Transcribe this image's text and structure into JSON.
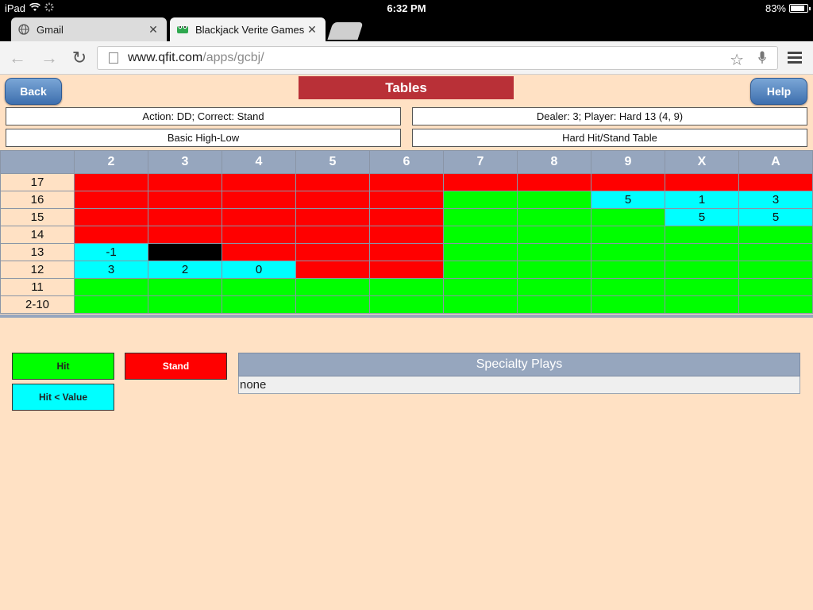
{
  "statusbar": {
    "device": "iPad",
    "time": "6:32 PM",
    "battery": "83%",
    "battery_level": 0.83
  },
  "tabs": [
    {
      "title": "Gmail",
      "active": false
    },
    {
      "title": "Blackjack Verite Games",
      "active": true
    }
  ],
  "toolbar": {
    "url_host": "www.qfit.com",
    "url_path": "/apps/gcbj/"
  },
  "page": {
    "back_label": "Back",
    "help_label": "Help",
    "title": "Tables",
    "action_text": "Action: DD; Correct: Stand",
    "dealer_text": "Dealer: 3; Player: Hard 13 (4, 9)",
    "system_text": "Basic High-Low",
    "table_name": "Hard Hit/Stand Table"
  },
  "grid": {
    "columns": [
      "2",
      "3",
      "4",
      "5",
      "6",
      "7",
      "8",
      "9",
      "X",
      "A"
    ],
    "rows": [
      {
        "label": "17",
        "cells": [
          {
            "c": "red",
            "v": ""
          },
          {
            "c": "red",
            "v": ""
          },
          {
            "c": "red",
            "v": ""
          },
          {
            "c": "red",
            "v": ""
          },
          {
            "c": "red",
            "v": ""
          },
          {
            "c": "red",
            "v": ""
          },
          {
            "c": "red",
            "v": ""
          },
          {
            "c": "red",
            "v": ""
          },
          {
            "c": "red",
            "v": ""
          },
          {
            "c": "red",
            "v": ""
          }
        ]
      },
      {
        "label": "16",
        "cells": [
          {
            "c": "red",
            "v": ""
          },
          {
            "c": "red",
            "v": ""
          },
          {
            "c": "red",
            "v": ""
          },
          {
            "c": "red",
            "v": ""
          },
          {
            "c": "red",
            "v": ""
          },
          {
            "c": "green",
            "v": ""
          },
          {
            "c": "green",
            "v": ""
          },
          {
            "c": "cyan",
            "v": "5"
          },
          {
            "c": "cyan",
            "v": "1"
          },
          {
            "c": "cyan",
            "v": "3"
          }
        ]
      },
      {
        "label": "15",
        "cells": [
          {
            "c": "red",
            "v": ""
          },
          {
            "c": "red",
            "v": ""
          },
          {
            "c": "red",
            "v": ""
          },
          {
            "c": "red",
            "v": ""
          },
          {
            "c": "red",
            "v": ""
          },
          {
            "c": "green",
            "v": ""
          },
          {
            "c": "green",
            "v": ""
          },
          {
            "c": "green",
            "v": ""
          },
          {
            "c": "cyan",
            "v": "5"
          },
          {
            "c": "cyan",
            "v": "5"
          }
        ]
      },
      {
        "label": "14",
        "cells": [
          {
            "c": "red",
            "v": ""
          },
          {
            "c": "red",
            "v": ""
          },
          {
            "c": "red",
            "v": ""
          },
          {
            "c": "red",
            "v": ""
          },
          {
            "c": "red",
            "v": ""
          },
          {
            "c": "green",
            "v": ""
          },
          {
            "c": "green",
            "v": ""
          },
          {
            "c": "green",
            "v": ""
          },
          {
            "c": "green",
            "v": ""
          },
          {
            "c": "green",
            "v": ""
          }
        ]
      },
      {
        "label": "13",
        "cells": [
          {
            "c": "cyan",
            "v": "-1"
          },
          {
            "c": "black",
            "v": ""
          },
          {
            "c": "red",
            "v": ""
          },
          {
            "c": "red",
            "v": ""
          },
          {
            "c": "red",
            "v": ""
          },
          {
            "c": "green",
            "v": ""
          },
          {
            "c": "green",
            "v": ""
          },
          {
            "c": "green",
            "v": ""
          },
          {
            "c": "green",
            "v": ""
          },
          {
            "c": "green",
            "v": ""
          }
        ]
      },
      {
        "label": "12",
        "cells": [
          {
            "c": "cyan",
            "v": "3"
          },
          {
            "c": "cyan",
            "v": "2"
          },
          {
            "c": "cyan",
            "v": "0"
          },
          {
            "c": "red",
            "v": ""
          },
          {
            "c": "red",
            "v": ""
          },
          {
            "c": "green",
            "v": ""
          },
          {
            "c": "green",
            "v": ""
          },
          {
            "c": "green",
            "v": ""
          },
          {
            "c": "green",
            "v": ""
          },
          {
            "c": "green",
            "v": ""
          }
        ]
      },
      {
        "label": "11",
        "cells": [
          {
            "c": "green",
            "v": ""
          },
          {
            "c": "green",
            "v": ""
          },
          {
            "c": "green",
            "v": ""
          },
          {
            "c": "green",
            "v": ""
          },
          {
            "c": "green",
            "v": ""
          },
          {
            "c": "green",
            "v": ""
          },
          {
            "c": "green",
            "v": ""
          },
          {
            "c": "green",
            "v": ""
          },
          {
            "c": "green",
            "v": ""
          },
          {
            "c": "green",
            "v": ""
          }
        ]
      },
      {
        "label": "2-10",
        "cells": [
          {
            "c": "green",
            "v": ""
          },
          {
            "c": "green",
            "v": ""
          },
          {
            "c": "green",
            "v": ""
          },
          {
            "c": "green",
            "v": ""
          },
          {
            "c": "green",
            "v": ""
          },
          {
            "c": "green",
            "v": ""
          },
          {
            "c": "green",
            "v": ""
          },
          {
            "c": "green",
            "v": ""
          },
          {
            "c": "green",
            "v": ""
          },
          {
            "c": "green",
            "v": ""
          }
        ]
      }
    ]
  },
  "legend": {
    "hit": "Hit",
    "stand": "Stand",
    "hit_value": "Hit < Value"
  },
  "specialty": {
    "title": "Specialty Plays",
    "value": "none"
  },
  "colors": {
    "red": "#ff0000",
    "green": "#00ff00",
    "cyan": "#00ffff",
    "black": "#000000",
    "title_red": "#b93037",
    "header_blue": "#96a6be",
    "page_bg": "#ffe1c4"
  }
}
